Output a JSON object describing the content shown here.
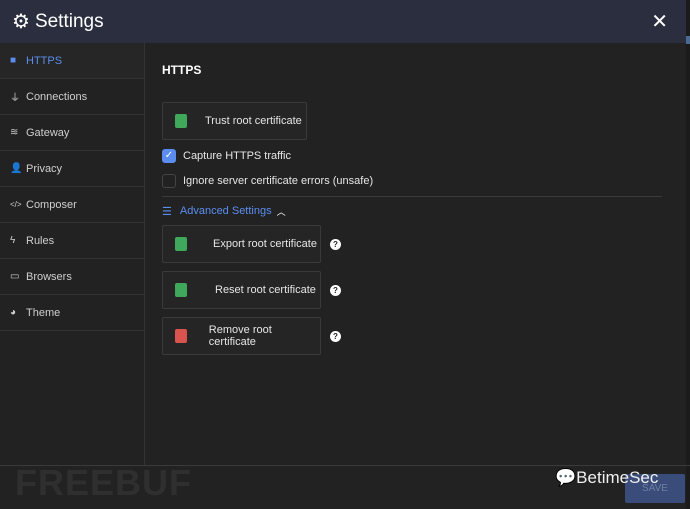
{
  "header": {
    "title": "Settings",
    "icon": "gear-icon",
    "close_icon": "close-icon"
  },
  "sidebar": {
    "items": [
      {
        "label": "HTTPS",
        "icon": "lock-icon",
        "glyph": "🔒",
        "active": true
      },
      {
        "label": "Connections",
        "icon": "plug-icon",
        "glyph": "⏚"
      },
      {
        "label": "Gateway",
        "icon": "wifi-icon",
        "glyph": "≋"
      },
      {
        "label": "Privacy",
        "icon": "user-shield-icon",
        "glyph": "👤"
      },
      {
        "label": "Composer",
        "icon": "code-icon",
        "glyph": "</>"
      },
      {
        "label": "Rules",
        "icon": "bolt-icon",
        "glyph": "ϟ"
      },
      {
        "label": "Browsers",
        "icon": "window-icon",
        "glyph": "▭"
      },
      {
        "label": "Theme",
        "icon": "palette-icon",
        "glyph": "◕"
      }
    ]
  },
  "main": {
    "heading": "HTTPS",
    "trust_button": "Trust root certificate",
    "capture": {
      "label": "Capture HTTPS traffic",
      "checked": true
    },
    "ignore": {
      "label": "Ignore server certificate errors (unsafe)",
      "checked": false
    },
    "advanced": {
      "label": "Advanced Settings",
      "expanded": true
    },
    "export_button": "Export root certificate",
    "reset_button": "Reset root certificate",
    "remove_button": "Remove root certificate",
    "help": "?"
  },
  "footer": {
    "save": "SAVE"
  },
  "watermarks": {
    "left": "FREEBUF",
    "right": "BetimeSec"
  },
  "colors": {
    "accent": "#5b8def",
    "header": "#2a2e3f",
    "cert_green": "#3fa85a",
    "cert_red": "#d9534f"
  }
}
